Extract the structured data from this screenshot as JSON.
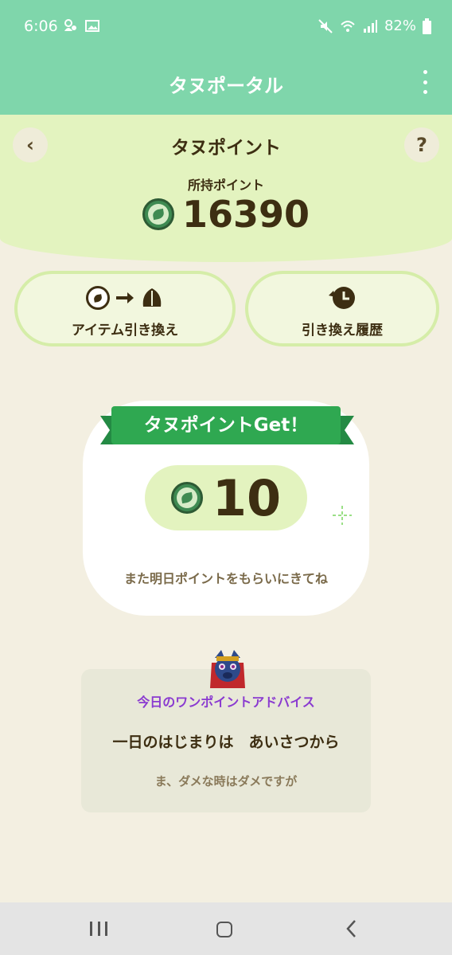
{
  "status_bar": {
    "time": "6:06",
    "battery": "82%"
  },
  "app_bar": {
    "title": "タヌポータル"
  },
  "header": {
    "title": "タヌポイント",
    "back_icon_glyph": "‹",
    "help_icon_glyph": "?",
    "owned_label": "所持ポイント",
    "owned_points": "16390"
  },
  "actions": {
    "exchange_label": "アイテム引き換え",
    "history_label": "引き換え履歴"
  },
  "get_card": {
    "ribbon_text": "タヌポイントGet！",
    "points": "10",
    "message": "また明日ポイントをもらいにきてね"
  },
  "advice": {
    "heading": "今日のワンポイントアドバイス",
    "main": "一日のはじまりは　あいさつから",
    "sub": "ま、ダメな時はダメですが"
  },
  "colors": {
    "app_bar": "#7fd6ab",
    "header_bg": "#e3f3bf",
    "page_bg": "#f3efe1",
    "ribbon": "#2fa851",
    "advice_heading": "#8a3ad0"
  },
  "icons": [
    "notification-icon",
    "image-icon",
    "mute-icon",
    "wifi-icon",
    "signal-icon",
    "battery-icon",
    "more-icon",
    "back-icon",
    "help-icon",
    "coin-icon",
    "arrow-right-icon",
    "leaf-icon",
    "history-icon",
    "sparkle-icon"
  ]
}
